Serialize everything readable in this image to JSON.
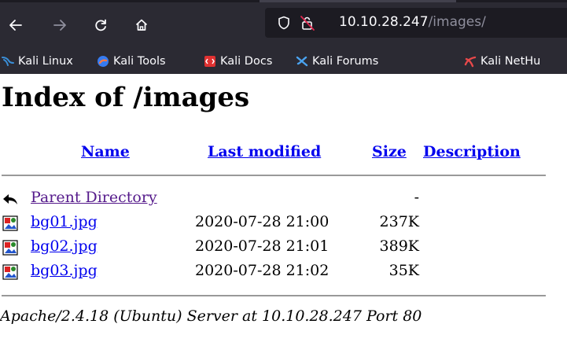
{
  "browser": {
    "url_host": "10.10.28.247",
    "url_path": "/images/",
    "bookmarks": [
      {
        "label": "Kali Linux",
        "icon": "kali-dragon-icon"
      },
      {
        "label": "Kali Tools",
        "icon": "kali-tools-icon"
      },
      {
        "label": "Kali Docs",
        "icon": "kali-docs-icon"
      },
      {
        "label": "Kali Forums",
        "icon": "kali-forums-icon"
      },
      {
        "label": "Kali NetHu",
        "icon": "kali-nethunter-icon"
      }
    ]
  },
  "page": {
    "title": "Index of /images",
    "columns": {
      "name": "Name",
      "last_modified": "Last modified",
      "size": "Size",
      "description": "Description"
    },
    "parent": {
      "name": "Parent Directory",
      "size": "-"
    },
    "files": [
      {
        "name": "bg01.jpg",
        "modified": "2020-07-28 21:00",
        "size": "237K",
        "icon": "image-file-icon"
      },
      {
        "name": "bg02.jpg",
        "modified": "2020-07-28 21:01",
        "size": "389K",
        "icon": "image-file-icon"
      },
      {
        "name": "bg03.jpg",
        "modified": "2020-07-28 21:02",
        "size": "35K",
        "icon": "image-file-icon"
      }
    ],
    "address": "Apache/2.4.18 (Ubuntu) Server at 10.10.28.247 Port 80"
  }
}
